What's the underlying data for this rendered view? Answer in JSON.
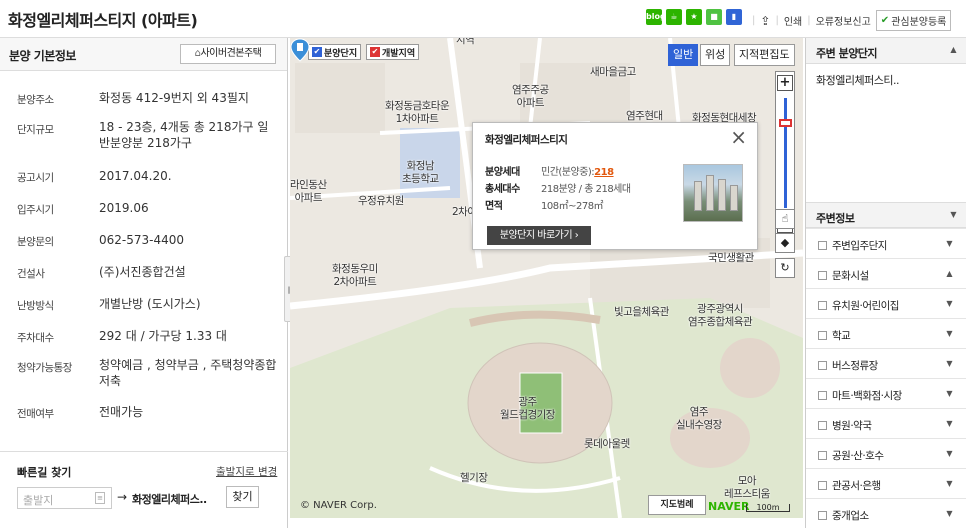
{
  "header": {
    "title": "화정엘리체퍼스티지 (아파트)",
    "share_icons": [
      {
        "name": "blog-share-icon",
        "color": "#2db400",
        "text": "blog"
      },
      {
        "name": "cafe-share-icon",
        "color": "#2db400",
        "text": ""
      },
      {
        "name": "bookmark-share-icon",
        "color": "#2db400",
        "text": ""
      },
      {
        "name": "band-share-icon",
        "color": "#4fc242",
        "text": ""
      },
      {
        "name": "memo-share-icon",
        "color": "#3065d6",
        "text": ""
      }
    ],
    "print_label": "인쇄",
    "report_label": "오류정보신고",
    "favorite_label": "관심분양등록"
  },
  "left": {
    "title": "분양 기본정보",
    "cyber_button": "사이버견본주택",
    "rows": [
      {
        "key": "분양주소",
        "value": "화정동 412-9번지 외 43필지"
      },
      {
        "key": "단지규모",
        "value": "18 - 23층, 4개동 총 218가구 일반분양분 218가구"
      },
      {
        "key": "공고시기",
        "value": "2017.04.20."
      },
      {
        "key": "입주시기",
        "value": "2019.06"
      },
      {
        "key": "분양문의",
        "value": "062-573-4400"
      },
      {
        "key": "건설사",
        "value": "(주)서진종합건설"
      },
      {
        "key": "난방방식",
        "value": "개별난방 (도시가스)"
      },
      {
        "key": "주차대수",
        "value": "292 대 / 가구당 1.33 대"
      },
      {
        "key": "청약가능통장",
        "value": "청약예금 , 청약부금 , 주택청약종합저축"
      },
      {
        "key": "전매여부",
        "value": "전매가능"
      }
    ],
    "quick": {
      "title": "빠른길 찾기",
      "change_label": "출발지로 변경",
      "departure_placeholder": "출발지",
      "destination": "화정엘리체퍼스..",
      "find_label": "찾기"
    }
  },
  "map": {
    "filters": [
      {
        "label": "분양단지",
        "color": "#2f62d6"
      },
      {
        "label": "개발지역",
        "color": "#d33"
      }
    ],
    "map_types": [
      "일반",
      "위성",
      "지적편집도"
    ],
    "labels": [
      {
        "text": "새마을금고"
      },
      {
        "text": "염주주공\n아파트"
      },
      {
        "text": "화정동금호타운\n1차아파트"
      },
      {
        "text": "염주현대"
      },
      {
        "text": "화정동현대세창"
      },
      {
        "text": "화정남\n초등학교"
      },
      {
        "text": "라인동산\n아파트"
      },
      {
        "text": "우정유치원"
      },
      {
        "text": "2차아"
      },
      {
        "text": "화정동우미\n2차아파트"
      },
      {
        "text": "국민생활관"
      },
      {
        "text": "빛고을체육관"
      },
      {
        "text": "광주광역시\n염주종합체육관"
      },
      {
        "text": "광주\n월드컵경기장"
      },
      {
        "text": "염주\n실내수영장"
      },
      {
        "text": "롯데아울렛"
      },
      {
        "text": "헬기장"
      },
      {
        "text": "모아\n레프스티움"
      },
      {
        "text": "지역"
      }
    ],
    "popup": {
      "title": "화정엘리체퍼스티지",
      "rows": [
        {
          "key": "분양세대",
          "value": "민간(분양중):",
          "highlight": "218"
        },
        {
          "key": "총세대수",
          "value": "218분양 / 총 218세대",
          "highlight": ""
        },
        {
          "key": "면적",
          "value": "108㎡~278㎡",
          "highlight": ""
        }
      ],
      "go_button": "분양단지 바로가기",
      "close": "×"
    },
    "copyright": "© NAVER Corp.",
    "legend_button": "지도범례",
    "naver_logo": "NAVER",
    "scale": "100m"
  },
  "right": {
    "near_title": "주변 분양단지",
    "near_items": [
      "화정엘리체퍼스티.."
    ],
    "poi_title": "주변정보",
    "poi_items": [
      "주변입주단지",
      "문화시설",
      "유치원·어린이집",
      "학교",
      "버스정류장",
      "마트·백화점·시장",
      "병원·약국",
      "공원·산·호수",
      "관공서·은행",
      "중개업소"
    ]
  }
}
